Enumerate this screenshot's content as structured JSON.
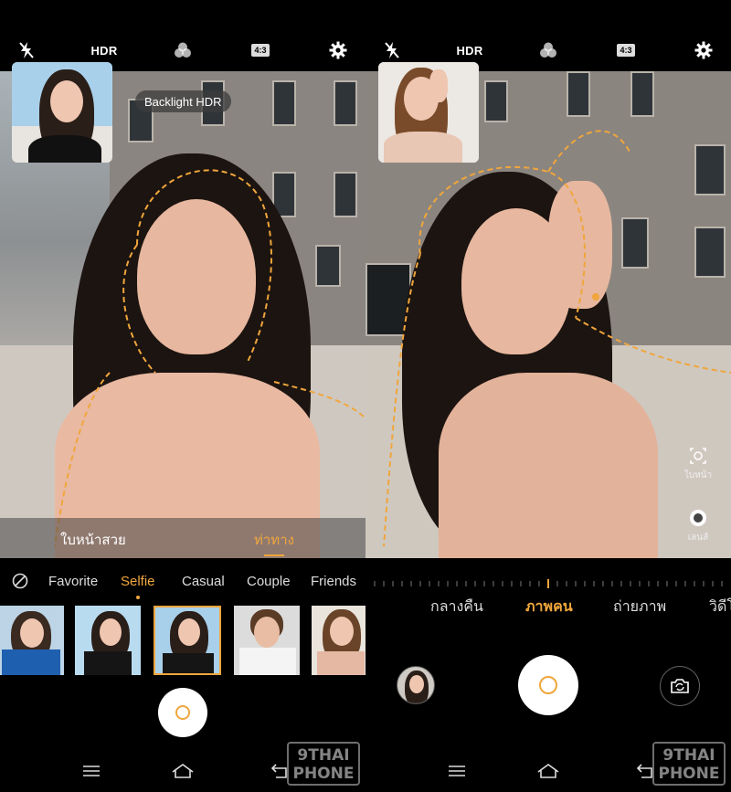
{
  "left": {
    "topbar": {
      "hdr": "HDR",
      "ratio": "4:3"
    },
    "toast": "Backlight HDR",
    "beauty": {
      "face_label": "ใบหน้าสวย",
      "pose_label": "ท่าทาง"
    },
    "filters": [
      {
        "label": "Favorite",
        "active": false
      },
      {
        "label": "Selfie",
        "active": true
      },
      {
        "label": "Casual",
        "active": false
      },
      {
        "label": "Couple",
        "active": false
      },
      {
        "label": "Friends",
        "active": false
      }
    ]
  },
  "right": {
    "topbar": {
      "hdr": "HDR",
      "ratio": "4:3"
    },
    "modes": [
      {
        "label": "กลางคืน",
        "active": false
      },
      {
        "label": "ภาพคน",
        "active": true
      },
      {
        "label": "ถ่ายภาพ",
        "active": false
      },
      {
        "label": "วิดีโ",
        "active": false
      }
    ],
    "side": {
      "face_label": "ใบหน้า",
      "lens_label": "เลนส์"
    }
  },
  "watermark": {
    "line1": "9THAI",
    "line2": "PHONE"
  },
  "colors": {
    "accent": "#f0a63c",
    "background": "#000000"
  },
  "icons": [
    "flash-off-icon",
    "filter-circles-icon",
    "settings-gear-icon",
    "no-filter-icon",
    "menu-icon",
    "home-icon",
    "back-icon",
    "switch-camera-icon",
    "face-beauty-icon",
    "lens-icon"
  ]
}
